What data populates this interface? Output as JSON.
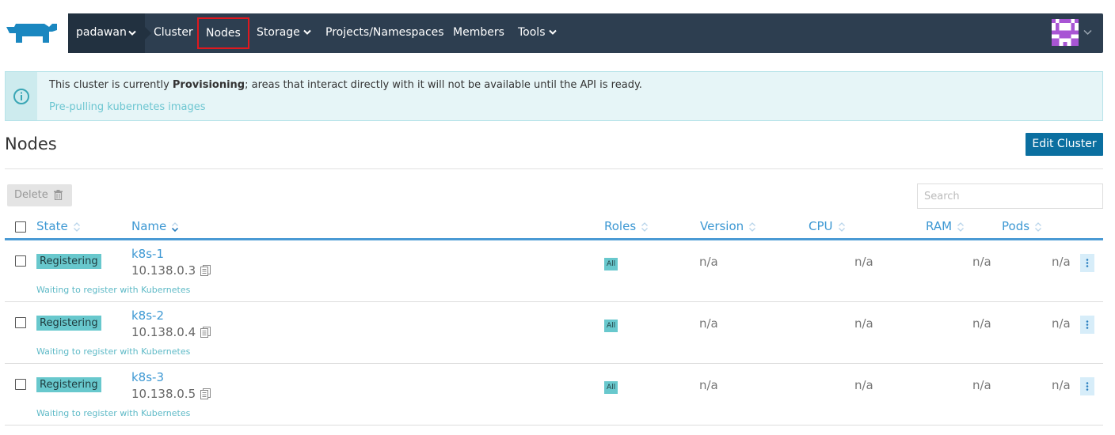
{
  "header": {
    "cluster_name": "padawan",
    "nav": [
      {
        "label": "Cluster"
      },
      {
        "label": "Nodes"
      },
      {
        "label": "Storage"
      },
      {
        "label": "Projects/Namespaces"
      },
      {
        "label": "Members"
      },
      {
        "label": "Tools"
      }
    ]
  },
  "banner": {
    "prefix": "This cluster is currently ",
    "state": "Provisioning",
    "suffix": "; areas that interact directly with it will not be available until the API is ready.",
    "sub": "Pre-pulling kubernetes images"
  },
  "page": {
    "title": "Nodes",
    "edit_button": "Edit Cluster"
  },
  "toolbar": {
    "delete_label": "Delete",
    "search_placeholder": "Search"
  },
  "table": {
    "columns": [
      "State",
      "Name",
      "Roles",
      "Version",
      "CPU",
      "RAM",
      "Pods"
    ],
    "rows": [
      {
        "state": "Registering",
        "state_detail": "Waiting to register with Kubernetes",
        "name": "k8s-1",
        "ip": "10.138.0.3",
        "role": "All",
        "version": "n/a",
        "cpu": "n/a",
        "ram": "n/a",
        "pods": "n/a"
      },
      {
        "state": "Registering",
        "state_detail": "Waiting to register with Kubernetes",
        "name": "k8s-2",
        "ip": "10.138.0.4",
        "role": "All",
        "version": "n/a",
        "cpu": "n/a",
        "ram": "n/a",
        "pods": "n/a"
      },
      {
        "state": "Registering",
        "state_detail": "Waiting to register with Kubernetes",
        "name": "k8s-3",
        "ip": "10.138.0.5",
        "role": "All",
        "version": "n/a",
        "cpu": "n/a",
        "ram": "n/a",
        "pods": "n/a"
      }
    ]
  },
  "colors": {
    "nav_bg": "#2d3e50",
    "accent": "#3d98d3",
    "primary_button": "#0b6fa0",
    "badge": "#68c8cd",
    "highlight_box": "#e0181e"
  },
  "icons": [
    "rancher-logo-icon",
    "chevron-down-icon",
    "avatar-icon",
    "info-icon",
    "trash-icon",
    "sort-icon",
    "copy-icon",
    "kebab-menu-icon"
  ]
}
